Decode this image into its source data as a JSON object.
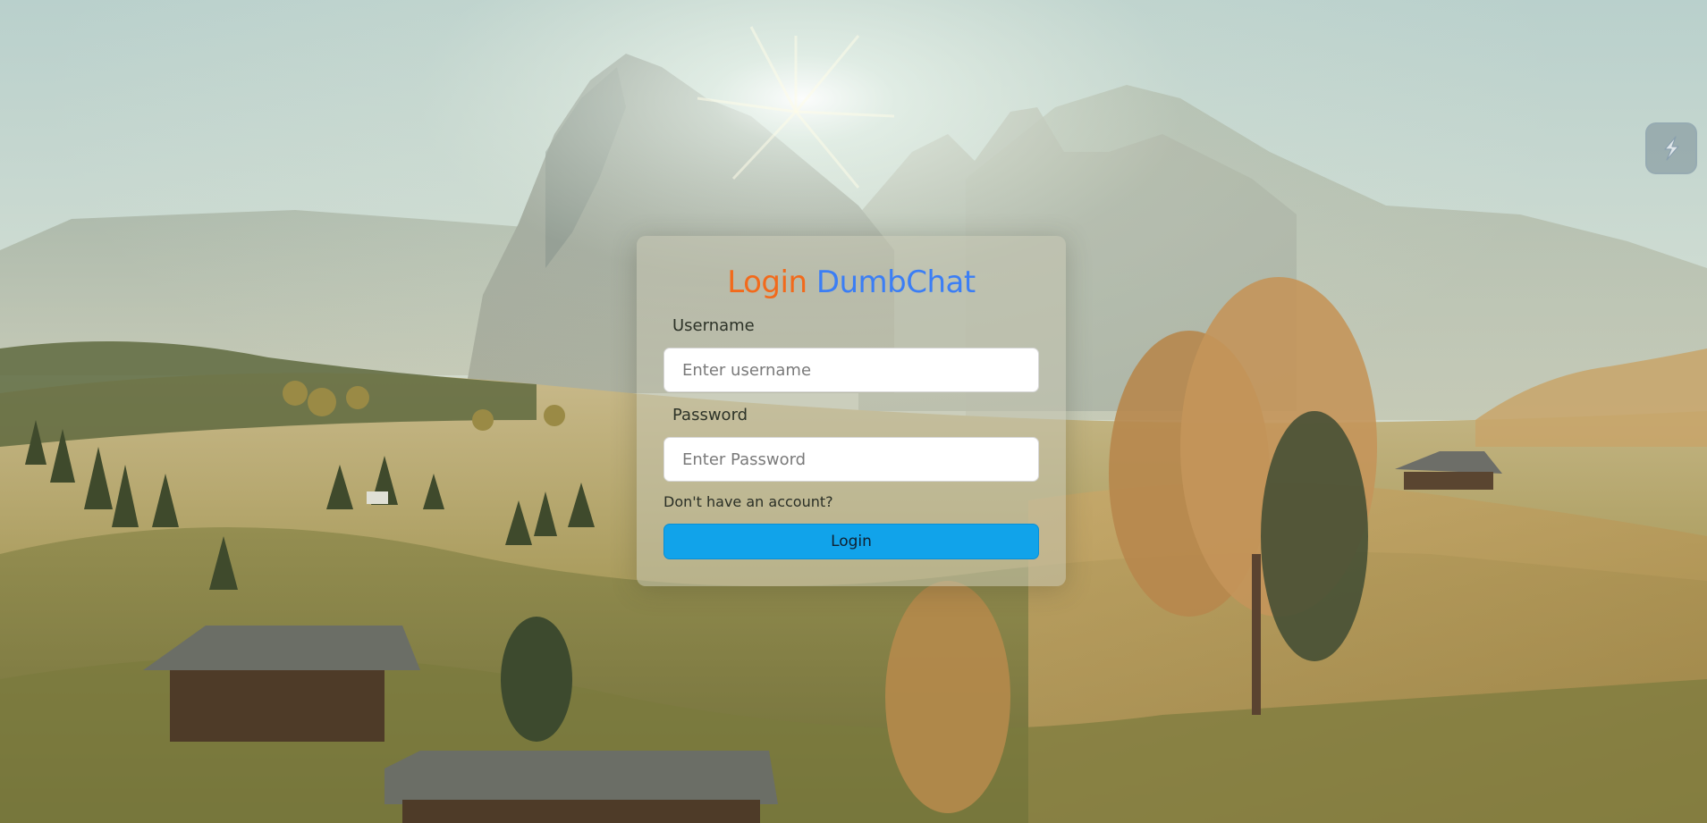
{
  "page": {
    "title_part_1": "Login",
    "title_part_2": "DumbChat",
    "title_color_1": "#f26a1b",
    "title_color_2": "#3b7ef5"
  },
  "form": {
    "username_label": "Username",
    "username_placeholder": "Enter username",
    "username_value": "",
    "password_label": "Password",
    "password_placeholder": "Enter Password",
    "password_value": "",
    "signup_link": "Don't have an account?",
    "submit_label": "Login",
    "submit_color": "#11a3ea"
  },
  "toolbar": {
    "theme_toggle_icon": "lightning-bolt-icon"
  },
  "background": {
    "scene_icon": "mountain-landscape-image"
  }
}
